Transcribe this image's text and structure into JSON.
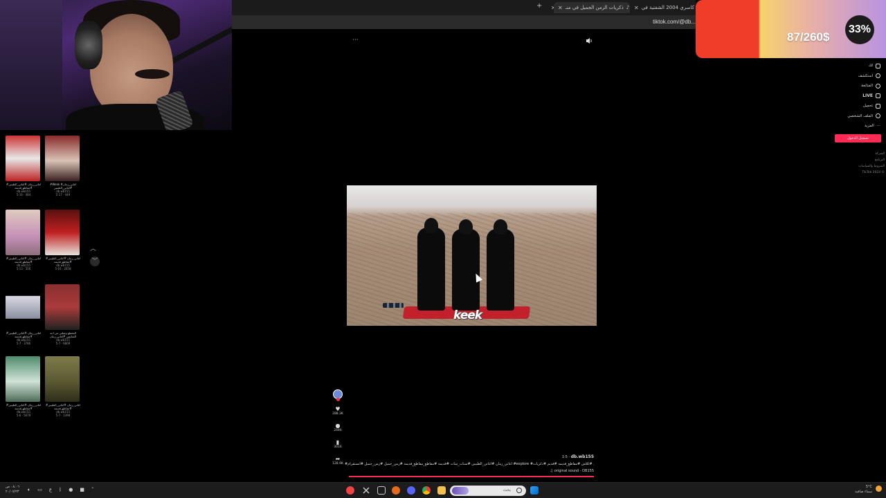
{
  "donation_goal": {
    "amount": "87/260$",
    "percent": "33%",
    "progress_fraction": 0.33
  },
  "browser": {
    "tabs": [
      {
        "title": "ذكريات الزمن الجميل في منـ",
        "active": true
      },
      {
        "title": "ستعرض كاسري 2004 الشفتية في"
      }
    ],
    "url": "tiktok.com/@db..."
  },
  "tiktok": {
    "nav": [
      {
        "label": "لك",
        "icon": "home-icon"
      },
      {
        "label": "استكشف",
        "icon": "compass-icon"
      },
      {
        "label": "المتابَعة",
        "icon": "user-icon"
      },
      {
        "label": "LIVE",
        "icon": "live-icon"
      },
      {
        "label": "تحميل",
        "icon": "upload-icon"
      },
      {
        "label": "الملف الشخصي",
        "icon": "profile-icon"
      },
      {
        "label": "المزيد",
        "icon": "more-icon"
      }
    ],
    "login_button": "تسجيل الدخول",
    "footer_links": [
      "الشركة",
      "البرنامج",
      "الشروط والسياسات",
      "TikTok 2024 ©"
    ],
    "video_watermark": "keek",
    "actions": [
      {
        "icon": "heart-icon",
        "count": "288.3K"
      },
      {
        "icon": "comment-icon",
        "count": "2446"
      },
      {
        "icon": "bookmark-icon",
        "count": "3016"
      },
      {
        "icon": "share-icon",
        "count": "128.9K"
      }
    ],
    "caption": {
      "username": "db.wb155",
      "date": "1-5",
      "text": "#اغاني_زمان #اغاني_الطيبين #سناب_شات #قديمة #مقاطع_مقاطع_قديمة #زمن_جميل #زمن_جميل #انستقرام #explore #اغاني_الزمن_الجميل #كلاش #مقاطع_قديمة #قديم #ذكريات",
      "sound": "original sound - DB155"
    },
    "progress_fraction": 1.0
  },
  "grid": [
    {
      "title": "#اغاني_زمان #اغاني_الطيبين #مقاطع_قديمة",
      "user": "db.wb155",
      "meta": "5-16 · 484"
    },
    {
      "title": "#Weak #اغاني_زمان #اغاني_الطيبين",
      "user": "db.wb155",
      "meta": "5-17 · 449"
    },
    {
      "title": "#اغاني_زمان #اغاني_الطيبين #مقاطع_قديمة",
      "user": "db.wb155",
      "meta": "5-13 · 356"
    },
    {
      "title": "#اغاني_زمان #اغاني_الطيبين #مقاطع_قديمة",
      "user": "db.wb155",
      "meta": "5-16 · 2658"
    },
    {
      "title": "#اغاني_زمان #اغاني_الطيبين #مقاطع_قديمة",
      "user": "db.wb155",
      "meta": "5-7 · 3786"
    },
    {
      "title": "المقطع وصلني من احد المتابعين #اغاني_زمان",
      "user": "db.wb155",
      "meta": "5-7 · 6809"
    },
    {
      "title": "#اغاني_زمان #اغاني_الطيبين #مقاطع_قديمة",
      "user": "db.wb155",
      "meta": "5-6 · 5679"
    },
    {
      "title": "#اغاني_زمان #اغاني_الطيبين #مقاطع_قديمة",
      "user": "db.wb155",
      "meta": "5-7 · 1398"
    }
  ],
  "taskbar": {
    "clock_time": "٠٨:٠٦ ص",
    "clock_date": "٢٠/٠٧/٢٣",
    "lang": "ع",
    "search_placeholder": "بحث",
    "weather_temp": "5°C",
    "weather_desc": "سماء صافية"
  }
}
